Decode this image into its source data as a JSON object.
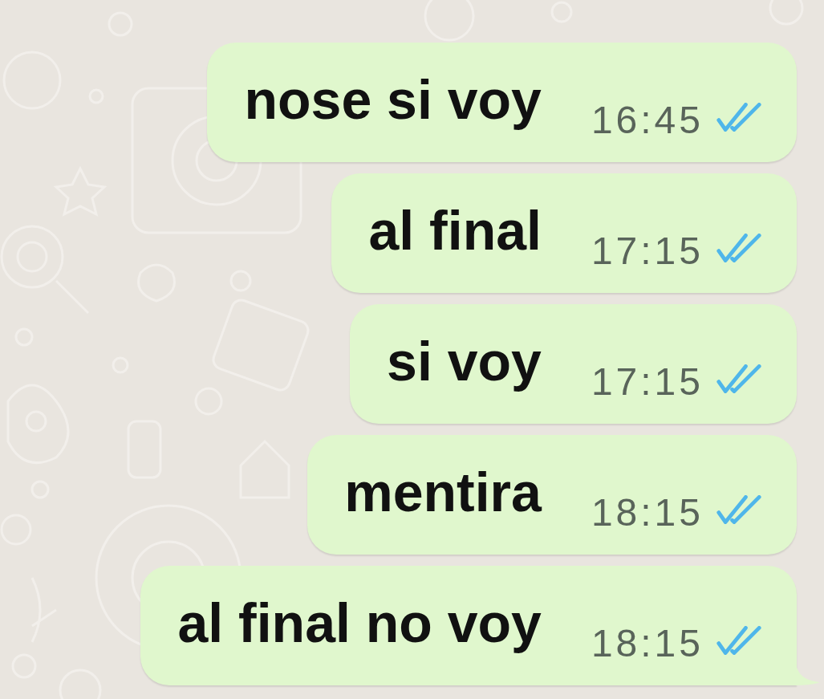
{
  "messages": [
    {
      "text": "nose si voy",
      "time": "16:45",
      "read": true,
      "tail": false
    },
    {
      "text": "al final",
      "time": "17:15",
      "read": true,
      "tail": false
    },
    {
      "text": "si voy",
      "time": "17:15",
      "read": true,
      "tail": false
    },
    {
      "text": "mentira",
      "time": "18:15",
      "read": true,
      "tail": false
    },
    {
      "text": "al final no voy",
      "time": "18:15",
      "read": true,
      "tail": true
    }
  ]
}
